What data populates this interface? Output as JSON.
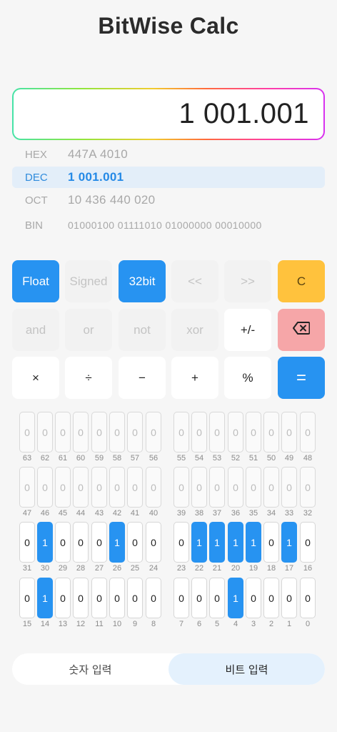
{
  "app": {
    "title": "BitWise Calc"
  },
  "display": {
    "value": "1 001.001"
  },
  "radix": [
    {
      "label": "HEX",
      "value": "447A 4010",
      "active": false
    },
    {
      "label": "DEC",
      "value": "1 001.001",
      "active": true
    },
    {
      "label": "OCT",
      "value": "10 436 440 020",
      "active": false
    },
    {
      "label": "BIN",
      "value": "01000100 01111010 01000000 00010000",
      "active": false
    }
  ],
  "keys": [
    {
      "name": "float-toggle",
      "label": "Float",
      "style": "blue"
    },
    {
      "name": "signed-toggle",
      "label": "Signed",
      "style": "ghost"
    },
    {
      "name": "32bit-toggle",
      "label": "32bit",
      "style": "blue"
    },
    {
      "name": "shift-left-button",
      "label": "<<",
      "style": "ghost"
    },
    {
      "name": "shift-right-button",
      "label": ">>",
      "style": "ghost"
    },
    {
      "name": "clear-button",
      "label": "C",
      "style": "yellow"
    },
    {
      "name": "and-button",
      "label": "and",
      "style": "ghost"
    },
    {
      "name": "or-button",
      "label": "or",
      "style": "ghost"
    },
    {
      "name": "not-button",
      "label": "not",
      "style": "ghost"
    },
    {
      "name": "xor-button",
      "label": "xor",
      "style": "ghost"
    },
    {
      "name": "negate-button",
      "label": "+/-",
      "style": "white"
    },
    {
      "name": "backspace-button",
      "label": "",
      "style": "pink",
      "icon": "backspace-icon"
    },
    {
      "name": "multiply-button",
      "label": "×",
      "style": "white"
    },
    {
      "name": "divide-button",
      "label": "÷",
      "style": "white"
    },
    {
      "name": "subtract-button",
      "label": "−",
      "style": "white"
    },
    {
      "name": "add-button",
      "label": "+",
      "style": "white"
    },
    {
      "name": "percent-button",
      "label": "%",
      "style": "white"
    },
    {
      "name": "equals-button",
      "label": "=",
      "style": "eq"
    }
  ],
  "bits": {
    "enabled_width": 32,
    "value_bits": "01000100011110100100000000010000",
    "disabled_text": "0"
  },
  "tabs": [
    {
      "label": "숫자 입력",
      "active": false
    },
    {
      "label": "비트 입력",
      "active": true
    }
  ],
  "colors": {
    "accent": "#2793f1",
    "clear": "#ffc23d",
    "backspace": "#f6a6a8"
  }
}
